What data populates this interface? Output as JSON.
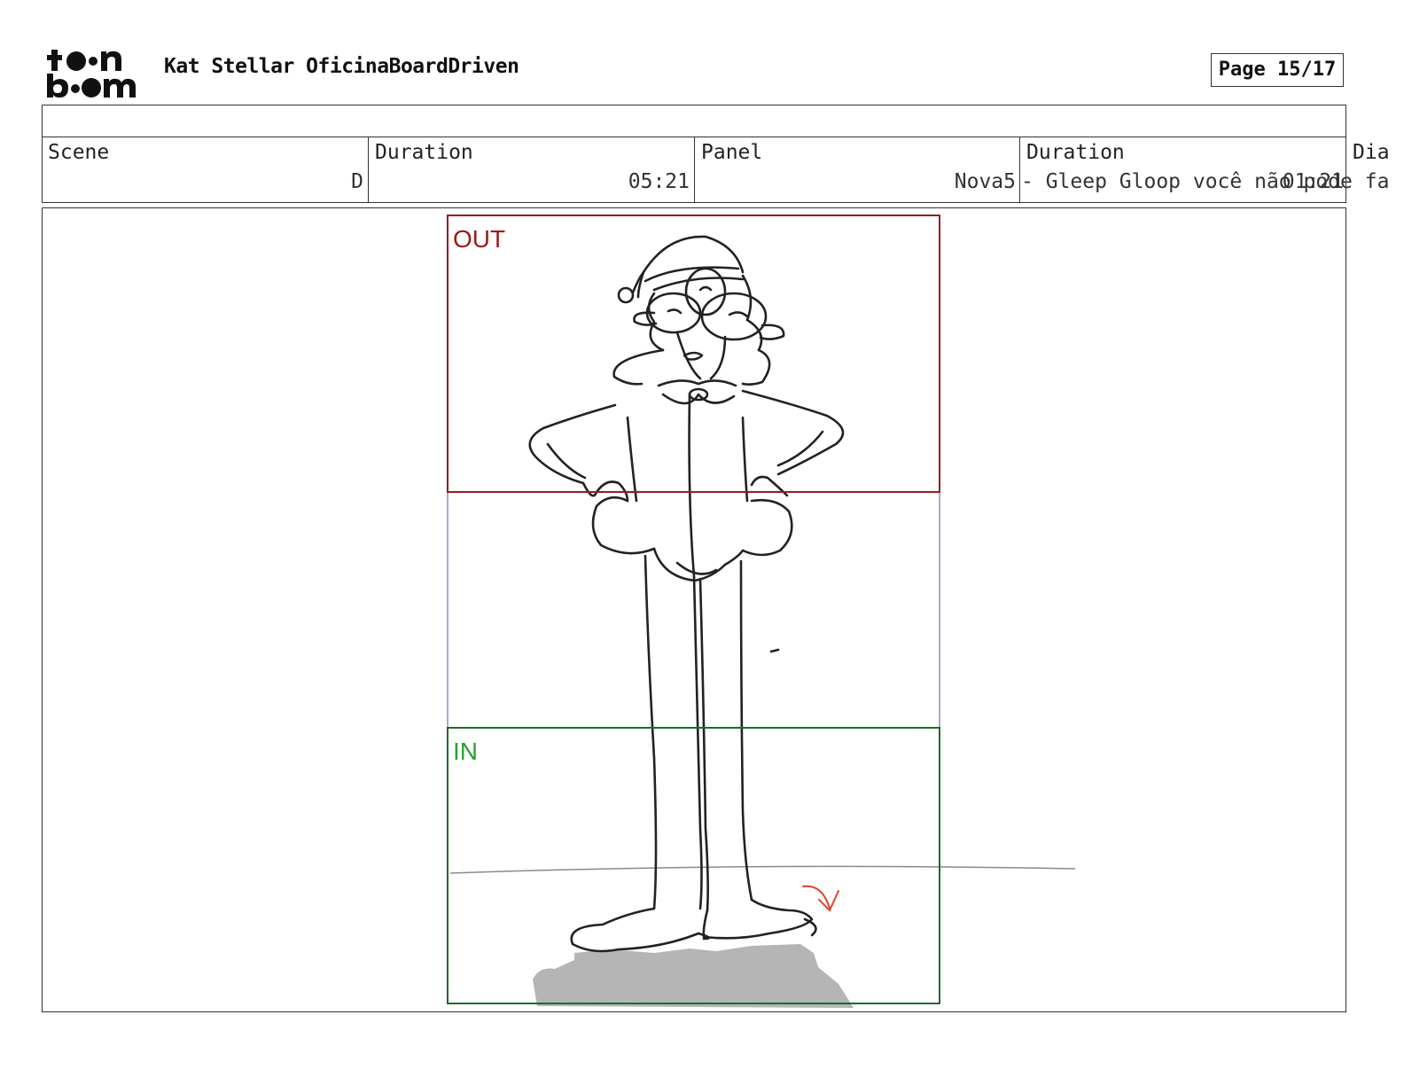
{
  "header": {
    "logo_text_top": "toon",
    "logo_text_bottom": "boom",
    "project_title": "Kat Stellar OficinaBoardDriven",
    "page_label": "Page 15/17"
  },
  "info": {
    "scene": {
      "label": "Scene",
      "value": "D"
    },
    "scene_duration": {
      "label": "Duration",
      "value": "05:21"
    },
    "panel": {
      "label": "Panel",
      "value": "Nova5"
    },
    "panel_duration": {
      "label": "Duration",
      "value": "01:21"
    },
    "dialogue": {
      "label": "Dia",
      "value": "- Gleep Gloop você não pode fa"
    }
  },
  "panel_frame": {
    "out_label": "OUT",
    "in_label": "IN",
    "colors": {
      "out_box": "#9b1b1b",
      "in_box": "#1f6b2a",
      "camera_path": "#a6a6e0",
      "sketch_line": "#222222",
      "shadow": "#b5b5b5",
      "motion_arrow": "#e0452b"
    }
  }
}
